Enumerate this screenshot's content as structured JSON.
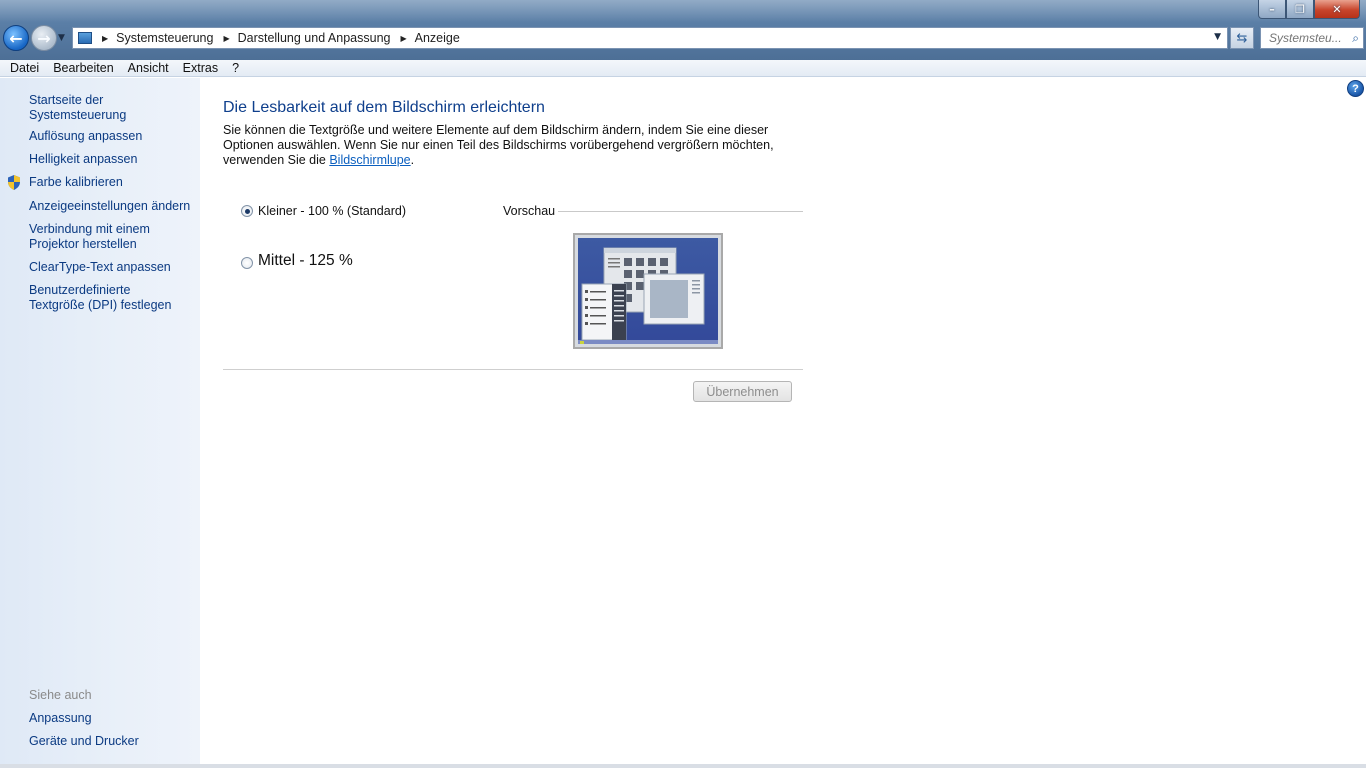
{
  "window": {
    "minimize": "–",
    "maximize": "❐",
    "close": "✕"
  },
  "address": {
    "breadcrumbs": [
      "Systemsteuerung",
      "Darstellung und Anpassung",
      "Anzeige"
    ],
    "search_placeholder": "Systemsteu..."
  },
  "menu": [
    "Datei",
    "Bearbeiten",
    "Ansicht",
    "Extras",
    "?"
  ],
  "sidebar": {
    "home": "Startseite der Systemsteuerung",
    "links": [
      "Auflösung anpassen",
      "Helligkeit anpassen",
      "Farbe kalibrieren",
      "Anzeigeeinstellungen ändern",
      "Verbindung mit einem Projektor herstellen",
      "ClearType-Text anpassen",
      "Benutzerdefinierte Textgröße (DPI) festlegen"
    ],
    "see_also_label": "Siehe auch",
    "see_also": [
      "Anpassung",
      "Geräte und Drucker"
    ]
  },
  "main": {
    "title": "Die Lesbarkeit auf dem Bildschirm erleichtern",
    "description": "Sie können die Textgröße und weitere Elemente auf dem Bildschirm ändern, indem Sie eine dieser Optionen auswählen. Wenn Sie nur einen Teil des Bildschirms vorübergehend vergrößern möchten, verwenden Sie die",
    "magnifier_link": "Bildschirmlupe",
    "description_end": ".",
    "options": [
      {
        "label": "Kleiner - 100 % (Standard)",
        "checked": true
      },
      {
        "label": "Mittel - 125 %",
        "checked": false
      }
    ],
    "preview_label": "Vorschau",
    "apply_button": "Übernehmen",
    "help": "?"
  }
}
